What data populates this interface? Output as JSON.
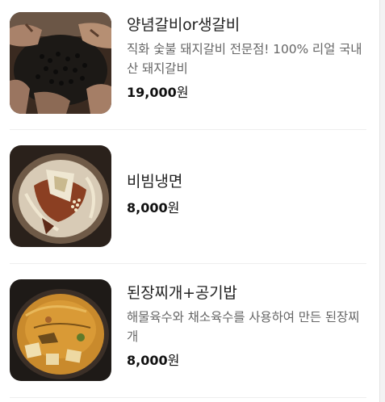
{
  "menu": {
    "items": [
      {
        "name": "양념갈비or생갈비",
        "description": "직화 숯불 돼지갈비 전문점! 100% 리얼 국내산 돼지갈비",
        "price": "19,000",
        "currency": "원",
        "image_icon": "grilled-ribs-photo"
      },
      {
        "name": "비빔냉면",
        "description": "",
        "price": "8,000",
        "currency": "원",
        "image_icon": "bibim-naengmyeon-photo"
      },
      {
        "name": "된장찌개+공기밥",
        "description": "해물육수와 채소육수를 사용하여 만든 된장찌개",
        "price": "8,000",
        "currency": "원",
        "image_icon": "doenjang-jjigae-photo"
      }
    ]
  },
  "colors": {
    "text": "#222222",
    "description": "#666666",
    "divider": "#eeeeee"
  }
}
